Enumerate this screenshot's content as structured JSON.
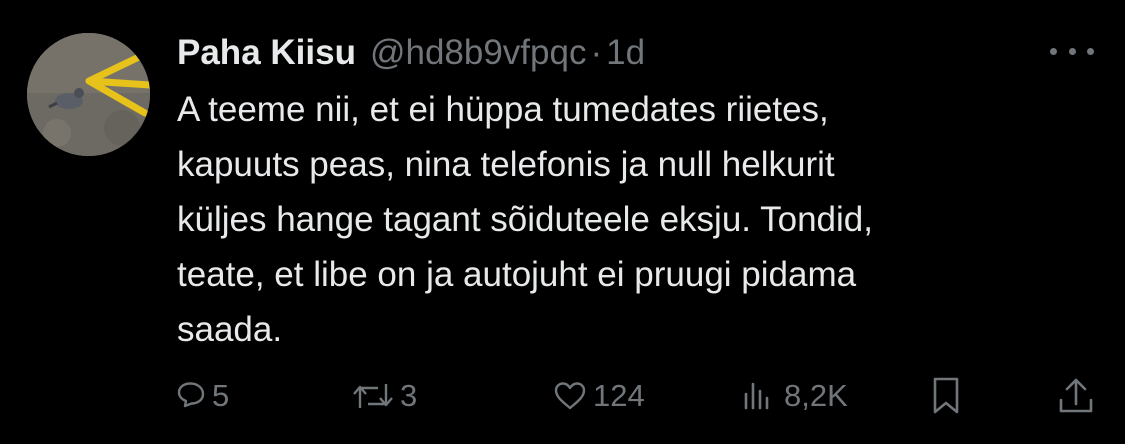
{
  "tweet": {
    "display_name": "Paha Kiisu",
    "handle": "@hd8b9vfpqc",
    "separator": "·",
    "time": "1d",
    "text": "A teeme nii, et ei hüppa tumedates riietes,\nkapuuts peas, nina telefonis ja null helkurit\nküljes hange tagant sõiduteele eksju. Tondid,\nteate, et libe on ja autojuht ei pruugi pidama\nsaada."
  },
  "actions": {
    "reply_count": "5",
    "retweet_count": "3",
    "like_count": "124",
    "views_count": "8,2K"
  },
  "icons": {
    "reply": "reply-icon",
    "retweet": "retweet-icon",
    "like": "heart-icon",
    "views": "views-icon",
    "bookmark": "bookmark-icon",
    "share": "share-icon",
    "more": "more-icon"
  },
  "colors": {
    "background": "#000000",
    "text": "#e7e9ea",
    "secondary": "#71767b"
  }
}
